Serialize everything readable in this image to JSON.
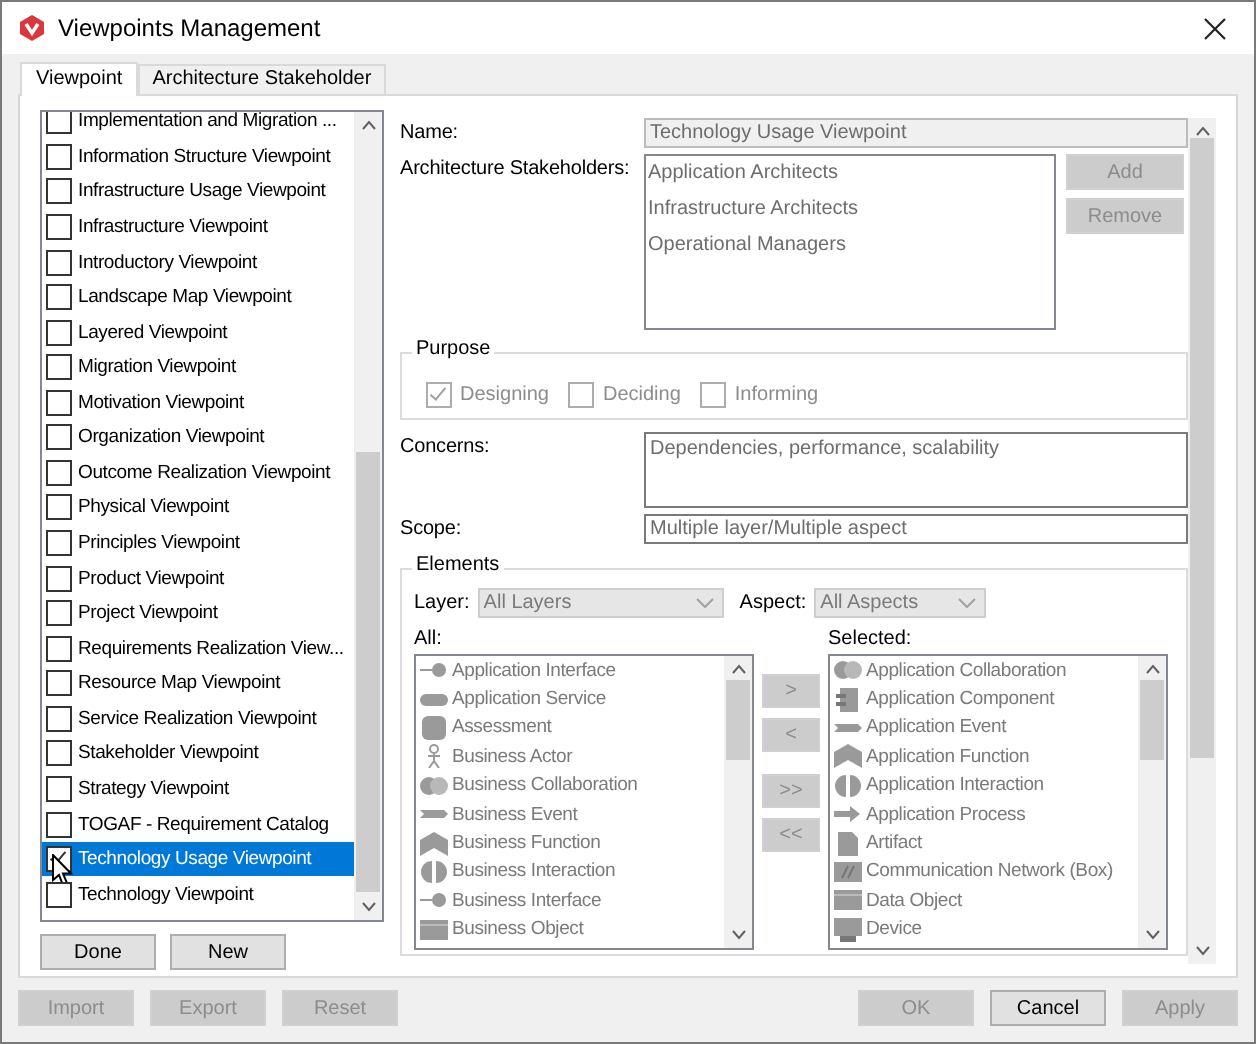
{
  "window": {
    "title": "Viewpoints Management"
  },
  "tabs": [
    {
      "label": "Viewpoint",
      "selected": true
    },
    {
      "label": "Architecture Stakeholder",
      "selected": false
    }
  ],
  "viewpoints": [
    {
      "label": "Implementation and Migration ...",
      "checked": false,
      "selected": false
    },
    {
      "label": "Information Structure Viewpoint",
      "checked": false,
      "selected": false
    },
    {
      "label": "Infrastructure Usage Viewpoint",
      "checked": false,
      "selected": false
    },
    {
      "label": "Infrastructure Viewpoint",
      "checked": false,
      "selected": false
    },
    {
      "label": "Introductory Viewpoint",
      "checked": false,
      "selected": false
    },
    {
      "label": "Landscape Map Viewpoint",
      "checked": false,
      "selected": false
    },
    {
      "label": "Layered Viewpoint",
      "checked": false,
      "selected": false
    },
    {
      "label": "Migration Viewpoint",
      "checked": false,
      "selected": false
    },
    {
      "label": "Motivation Viewpoint",
      "checked": false,
      "selected": false
    },
    {
      "label": "Organization Viewpoint",
      "checked": false,
      "selected": false
    },
    {
      "label": "Outcome Realization Viewpoint",
      "checked": false,
      "selected": false
    },
    {
      "label": "Physical Viewpoint",
      "checked": false,
      "selected": false
    },
    {
      "label": "Principles Viewpoint",
      "checked": false,
      "selected": false
    },
    {
      "label": "Product Viewpoint",
      "checked": false,
      "selected": false
    },
    {
      "label": "Project Viewpoint",
      "checked": false,
      "selected": false
    },
    {
      "label": "Requirements Realization View...",
      "checked": false,
      "selected": false
    },
    {
      "label": "Resource Map Viewpoint",
      "checked": false,
      "selected": false
    },
    {
      "label": "Service Realization Viewpoint",
      "checked": false,
      "selected": false
    },
    {
      "label": "Stakeholder Viewpoint",
      "checked": false,
      "selected": false
    },
    {
      "label": "Strategy Viewpoint",
      "checked": false,
      "selected": false
    },
    {
      "label": "TOGAF - Requirement Catalog",
      "checked": false,
      "selected": false
    },
    {
      "label": "Technology Usage Viewpoint",
      "checked": true,
      "selected": true
    },
    {
      "label": "Technology Viewpoint",
      "checked": false,
      "selected": false
    }
  ],
  "list_buttons": [
    {
      "label": "Done",
      "disabled": false
    },
    {
      "label": "New",
      "disabled": false
    }
  ],
  "form": {
    "name": {
      "label": "Name:",
      "value": "Technology Usage Viewpoint",
      "disabled": true
    },
    "stakeholders": {
      "label": "Architecture Stakeholders:",
      "items": [
        "Application Architects",
        "Infrastructure Architects",
        "Operational Managers"
      ],
      "buttons": [
        {
          "label": "Add",
          "disabled": true
        },
        {
          "label": "Remove",
          "disabled": true
        }
      ]
    },
    "purpose": {
      "title": "Purpose",
      "options": [
        {
          "label": "Designing",
          "checked": true,
          "disabled": true
        },
        {
          "label": "Deciding",
          "checked": false,
          "disabled": true
        },
        {
          "label": "Informing",
          "checked": false,
          "disabled": true
        }
      ]
    },
    "concerns": {
      "label": "Concerns:",
      "value": "Dependencies, performance, scalability"
    },
    "scope": {
      "label": "Scope:",
      "value": "Multiple layer/Multiple aspect"
    },
    "elements": {
      "title": "Elements",
      "layer": {
        "label": "Layer:",
        "value": "All Layers",
        "disabled": true
      },
      "aspect": {
        "label": "Aspect:",
        "value": "All Aspects",
        "disabled": true
      },
      "all": {
        "label": "All:",
        "items": [
          "Application Interface",
          "Application Service",
          "Assessment",
          "Business Actor",
          "Business Collaboration",
          "Business Event",
          "Business Function",
          "Business Interaction",
          "Business Interface",
          "Business Object"
        ]
      },
      "move_buttons": [
        {
          "label": ">",
          "disabled": true
        },
        {
          "label": "<",
          "disabled": true
        },
        {
          "label": ">>",
          "disabled": true
        },
        {
          "label": "<<",
          "disabled": true
        }
      ],
      "selected": {
        "label": "Selected:",
        "items": [
          "Application Collaboration",
          "Application Component",
          "Application Event",
          "Application Function",
          "Application Interaction",
          "Application Process",
          "Artifact",
          "Communication Network (Box)",
          "Data Object",
          "Device"
        ]
      }
    }
  },
  "footer_left": [
    {
      "label": "Import",
      "disabled": true
    },
    {
      "label": "Export",
      "disabled": true
    },
    {
      "label": "Reset",
      "disabled": true
    }
  ],
  "footer_right": [
    {
      "label": "OK",
      "disabled": true
    },
    {
      "label": "Cancel",
      "disabled": false
    },
    {
      "label": "Apply",
      "disabled": true
    }
  ]
}
